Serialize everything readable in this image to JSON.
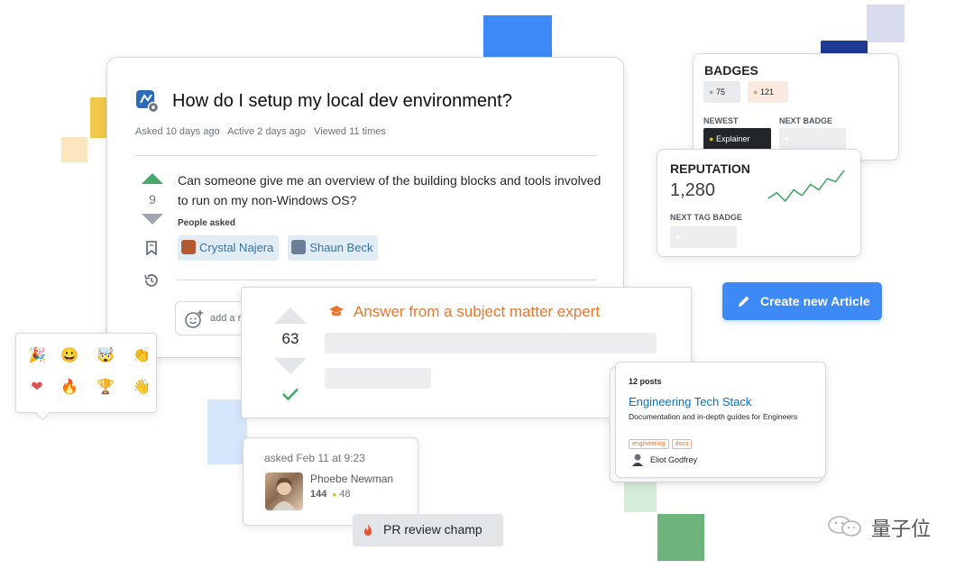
{
  "colors": {
    "accent_blue": "#3d8af7",
    "upvote_green": "#48a868",
    "expert_orange": "#e8772e",
    "gold": "#f0b400",
    "navy": "#1f3a93"
  },
  "question": {
    "icon": "product-logo-icon",
    "title": "How do I setup my local dev environment?",
    "meta": [
      "Asked 10 days ago",
      "Active 2 days ago",
      "Viewed 11 times"
    ],
    "votes": "9",
    "body": "Can someone give me an overview of the building blocks and tools involved to run on my non-Windows OS?",
    "people_asked_label": "People asked",
    "people": [
      {
        "name": "Crystal Najera",
        "avatar_color": "#b35a32"
      },
      {
        "name": "Shaun Beck",
        "avatar_color": "#6b7f99"
      }
    ],
    "comment_placeholder": "add a r"
  },
  "answer": {
    "votes": "63",
    "label": "Answer from a subject matter expert",
    "icon": "graduation-cap-icon"
  },
  "badges": {
    "title": "BADGES",
    "silver_count": "75",
    "bronze_count": "121",
    "newest_label": "NEWEST",
    "next_badge_label": "NEXT BADGE",
    "newest_badge": "Explainer"
  },
  "reputation": {
    "title": "REPUTATION",
    "value": "1,280",
    "next_tag_badge_label": "NEXT TAG BADGE",
    "sparkline": [
      3,
      5,
      2,
      6,
      4,
      8,
      6,
      10,
      9,
      13
    ]
  },
  "create_button": {
    "label": "Create new Article",
    "icon": "pencil-icon"
  },
  "collection": {
    "posts": "12 posts",
    "title": "Engineering Tech Stack",
    "description": "Documentation and in-depth guides for Engineers",
    "tags": [
      "engineering",
      "docs"
    ],
    "author": "Eliot Godfrey"
  },
  "asker": {
    "asked": "asked Feb 11 at 9:23",
    "name": "Phoebe Newman",
    "rep": "144",
    "bronze": "48"
  },
  "pr_badge": {
    "label": "PR review champ",
    "icon": "flame-icon"
  },
  "reactions": [
    "🎉",
    "😀",
    "🤯",
    "👏",
    "❤",
    "🔥",
    "🏆",
    "👋"
  ],
  "watermark": "量子位"
}
